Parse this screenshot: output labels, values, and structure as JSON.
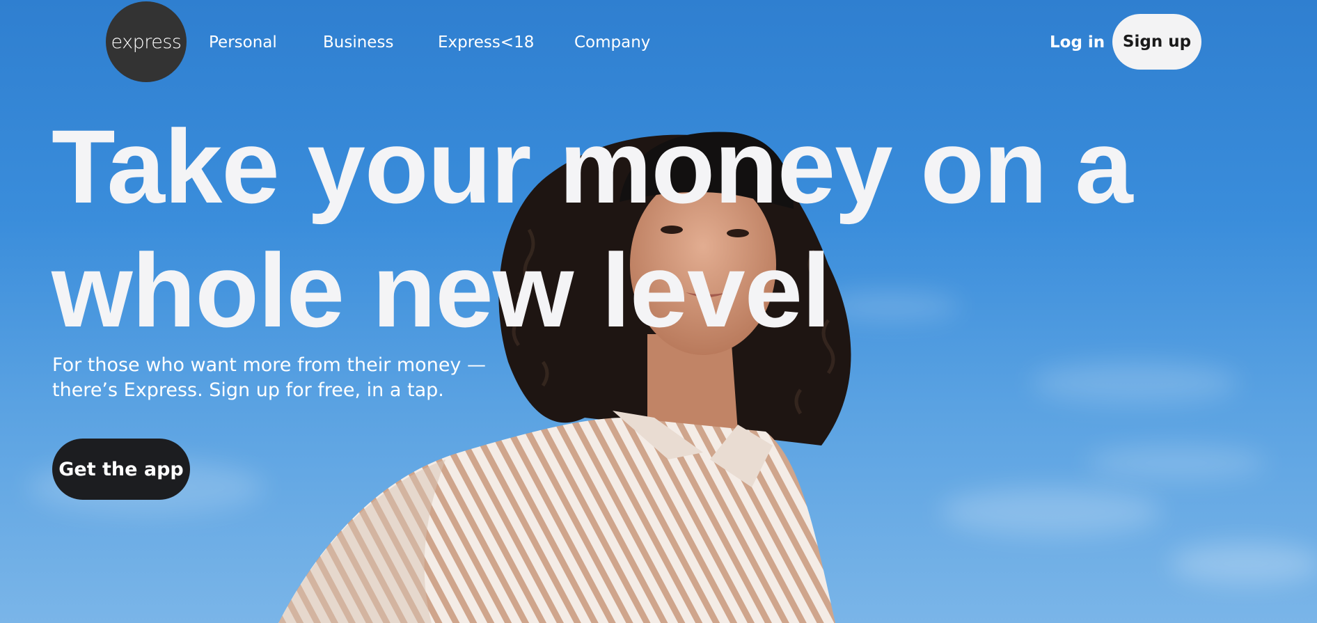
{
  "brand": {
    "logo_text": "express"
  },
  "nav": {
    "items": [
      {
        "label": "Personal"
      },
      {
        "label": "Business"
      },
      {
        "label": "Express<18"
      },
      {
        "label": "Company"
      }
    ],
    "login_label": "Log in",
    "signup_label": "Sign up"
  },
  "hero": {
    "headline": "Take your money on a whole new level",
    "subtitle": "For those who want more from their money — there’s Express. Sign up for free, in a tap.",
    "cta_label": "Get the app"
  },
  "colors": {
    "sky": "#3a8ddb",
    "logo_bg": "#333333",
    "signup_bg": "#f3f3f4",
    "cta_bg": "#1c1d20",
    "text_light": "#f4f4f6"
  }
}
